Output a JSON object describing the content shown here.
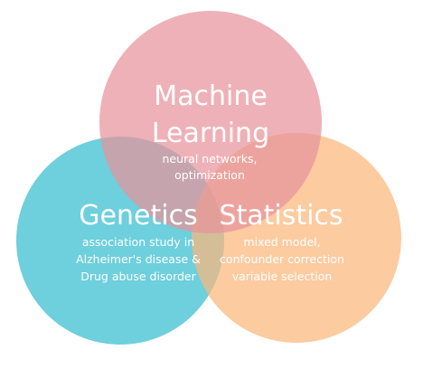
{
  "colors": {
    "machine_learning": "#e8939b",
    "genetics": "#4ec4d6",
    "statistics": "#fbb77c",
    "text": "#ffffff"
  },
  "sets": {
    "machine_learning": {
      "title_line1": "Machine",
      "title_line2": "Learning",
      "desc_line1": "neural networks,",
      "desc_line2": "optimization"
    },
    "genetics": {
      "title": "Genetics",
      "desc_line1": "association study in",
      "desc_line2": "Alzheimer's disease &",
      "desc_line3": "Drug abuse disorder"
    },
    "statistics": {
      "title": "Statistics",
      "desc_line1": "mixed model,",
      "desc_line2": "confounder correction",
      "desc_line3": "variable selection"
    }
  }
}
